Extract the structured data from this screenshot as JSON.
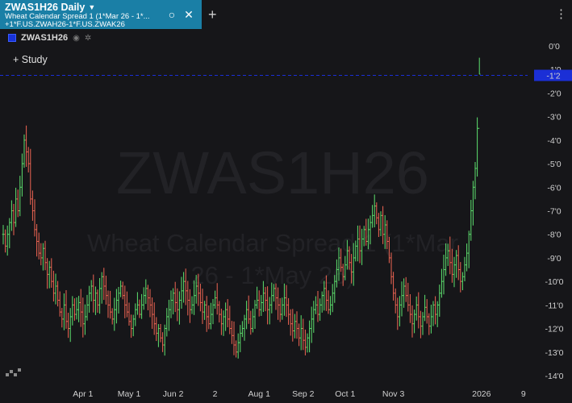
{
  "tab": {
    "title": "ZWAS1H26 Daily",
    "subtitle_line1": "Wheat Calendar Spread 1 (1*Mar 26 - 1*...",
    "subtitle_line2": "+1*F.US.ZWAH26-1*F.US.ZWAK26"
  },
  "legend": {
    "symbol": "ZWAS1H26",
    "color": "#1832d8"
  },
  "study_button": {
    "label": "Study"
  },
  "watermark": {
    "symbol": "ZWAS1H26",
    "line1": "Wheat Calendar Spread 1 (1*Mar",
    "line2": "26 - 1*May 26)"
  },
  "price_marker": {
    "label": "-1'2",
    "value": -1.25
  },
  "colors": {
    "up": "#5ee06e",
    "down": "#f06553",
    "accent": "#1a7fa6",
    "marker": "#1b2fd6"
  },
  "chart_data": {
    "type": "ohlc",
    "ylim": [
      -14,
      0
    ],
    "y_ticks": [
      {
        "v": 0,
        "label": "0'0"
      },
      {
        "v": -1,
        "label": "-1'0"
      },
      {
        "v": -2,
        "label": "-2'0"
      },
      {
        "v": -3,
        "label": "-3'0"
      },
      {
        "v": -4,
        "label": "-4'0"
      },
      {
        "v": -5,
        "label": "-5'0"
      },
      {
        "v": -6,
        "label": "-6'0"
      },
      {
        "v": -7,
        "label": "-7'0"
      },
      {
        "v": -8,
        "label": "-8'0"
      },
      {
        "v": -9,
        "label": "-9'0"
      },
      {
        "v": -10,
        "label": "-10'0"
      },
      {
        "v": -11,
        "label": "-11'0"
      },
      {
        "v": -12,
        "label": "-12'0"
      },
      {
        "v": -13,
        "label": "-13'0"
      },
      {
        "v": -14,
        "label": "-14'0"
      }
    ],
    "x_ticks": [
      {
        "bar": 38,
        "label": "Apr 1"
      },
      {
        "bar": 60,
        "label": "May 1"
      },
      {
        "bar": 81,
        "label": "Jun 2"
      },
      {
        "bar": 101,
        "label": "2"
      },
      {
        "bar": 122,
        "label": "Aug 1"
      },
      {
        "bar": 143,
        "label": "Sep 2"
      },
      {
        "bar": 163,
        "label": "Oct 1"
      },
      {
        "bar": 186,
        "label": "Nov 3"
      },
      {
        "bar": 228,
        "label": "2026"
      },
      {
        "bar": 248,
        "label": "9"
      }
    ],
    "closes": [
      -8.0,
      -8.5,
      -8.0,
      -7.5,
      -7.0,
      -7.5,
      -6.5,
      -7.0,
      -6.0,
      -5.0,
      -4.0,
      -4.5,
      -5.0,
      -6.5,
      -7.0,
      -7.8,
      -8.3,
      -8.8,
      -9.0,
      -8.6,
      -9.2,
      -9.7,
      -9.4,
      -10.0,
      -10.5,
      -10.2,
      -10.8,
      -11.3,
      -11.6,
      -11.0,
      -11.7,
      -12.0,
      -11.5,
      -11.0,
      -11.4,
      -11.2,
      -10.9,
      -11.3,
      -11.8,
      -11.5,
      -11.0,
      -10.5,
      -10.2,
      -10.8,
      -10.5,
      -11.0,
      -10.3,
      -9.8,
      -10.2,
      -10.6,
      -11.0,
      -11.3,
      -11.6,
      -11.2,
      -10.8,
      -10.5,
      -10.2,
      -10.6,
      -11.0,
      -11.3,
      -11.7,
      -12.0,
      -11.6,
      -11.2,
      -11.0,
      -11.4,
      -11.0,
      -10.6,
      -10.3,
      -10.7,
      -11.0,
      -11.4,
      -11.8,
      -12.2,
      -12.0,
      -12.4,
      -12.7,
      -12.0,
      -11.5,
      -11.2,
      -10.8,
      -10.5,
      -10.9,
      -11.2,
      -10.8,
      -10.4,
      -10.0,
      -10.4,
      -10.8,
      -11.2,
      -11.0,
      -10.6,
      -10.2,
      -10.5,
      -10.9,
      -11.3,
      -11.0,
      -11.5,
      -11.8,
      -11.4,
      -11.0,
      -10.7,
      -11.0,
      -11.4,
      -11.8,
      -11.5,
      -11.2,
      -11.6,
      -12.0,
      -12.3,
      -12.7,
      -13.0,
      -12.6,
      -12.2,
      -12.0,
      -11.6,
      -11.2,
      -11.6,
      -12.0,
      -11.5,
      -11.0,
      -10.8,
      -11.2,
      -10.9,
      -10.5,
      -10.8,
      -11.2,
      -11.0,
      -10.6,
      -10.3,
      -10.7,
      -11.0,
      -11.4,
      -11.0,
      -10.7,
      -11.0,
      -11.4,
      -11.8,
      -12.1,
      -11.7,
      -12.0,
      -12.4,
      -12.0,
      -12.5,
      -12.8,
      -12.4,
      -12.0,
      -11.6,
      -11.2,
      -11.0,
      -11.4,
      -11.0,
      -10.6,
      -10.3,
      -10.8,
      -11.2,
      -11.0,
      -10.5,
      -10.0,
      -9.5,
      -9.0,
      -9.4,
      -9.8,
      -9.3,
      -8.7,
      -9.2,
      -9.6,
      -9.0,
      -8.5,
      -8.2,
      -8.7,
      -8.2,
      -7.8,
      -8.3,
      -7.8,
      -7.5,
      -7.2,
      -6.8,
      -7.3,
      -7.8,
      -7.2,
      -8.0,
      -7.6,
      -8.3,
      -9.0,
      -9.8,
      -10.5,
      -11.0,
      -11.5,
      -11.0,
      -10.6,
      -10.2,
      -10.6,
      -11.0,
      -11.4,
      -11.8,
      -11.4,
      -11.0,
      -11.5,
      -11.9,
      -11.5,
      -11.1,
      -11.5,
      -11.9,
      -11.5,
      -11.0,
      -11.4,
      -11.0,
      -10.5,
      -10.0,
      -9.5,
      -9.0,
      -8.7,
      -9.2,
      -9.7,
      -9.3,
      -8.9,
      -9.5,
      -10.0,
      -9.8,
      -9.3,
      -8.8,
      -8.0,
      -7.0,
      -6.0,
      -5.2,
      -3.5,
      -1.2
    ]
  }
}
